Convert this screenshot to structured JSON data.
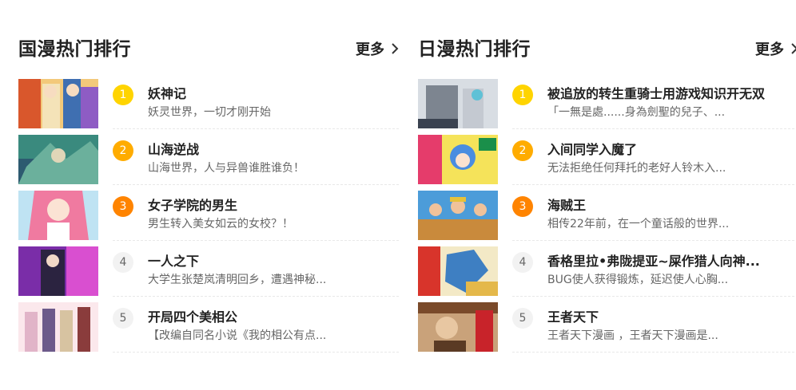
{
  "guoman": {
    "title": "国漫热门排行",
    "more": "更多",
    "items": [
      {
        "rank": "1",
        "name": "妖神记",
        "desc": "妖灵世界，一切才刚开始"
      },
      {
        "rank": "2",
        "name": "山海逆战",
        "desc": "山海世界，人与异兽谁胜谁负！"
      },
      {
        "rank": "3",
        "name": "女子学院的男生",
        "desc": "男生转入美女如云的女校？！"
      },
      {
        "rank": "4",
        "name": "一人之下",
        "desc": "大学生张楚岚清明回乡，遭遇神秘..."
      },
      {
        "rank": "5",
        "name": "开局四个美相公",
        "desc": "【改编自同名小说《我的相公有点..."
      }
    ]
  },
  "riman": {
    "title": "日漫热门排行",
    "more": "更多",
    "items": [
      {
        "rank": "1",
        "name": "被追放的转生重骑士用游戏知识开无双",
        "desc": "「一無是處......身為劍聖的兒子、..."
      },
      {
        "rank": "2",
        "name": "入间同学入魔了",
        "desc": "无法拒绝任何拜托的老好人铃木入..."
      },
      {
        "rank": "3",
        "name": "海贼王",
        "desc": "相传22年前，在一个童话般的世界..."
      },
      {
        "rank": "4",
        "name": "香格里拉•弗陇提亚~屎作猎人向神...",
        "desc": "BUG使人获得锻炼，延迟使人心胸..."
      },
      {
        "rank": "5",
        "name": "王者天下",
        "desc": "王者天下漫画 ，王者天下漫画是..."
      }
    ]
  },
  "colors": {
    "rank1": "#ffd400",
    "rank2": "#ffac00",
    "rank3": "#ff8400",
    "rank_other": "#f2f2f2"
  },
  "icons": {
    "more": "chevron-right-icon"
  }
}
